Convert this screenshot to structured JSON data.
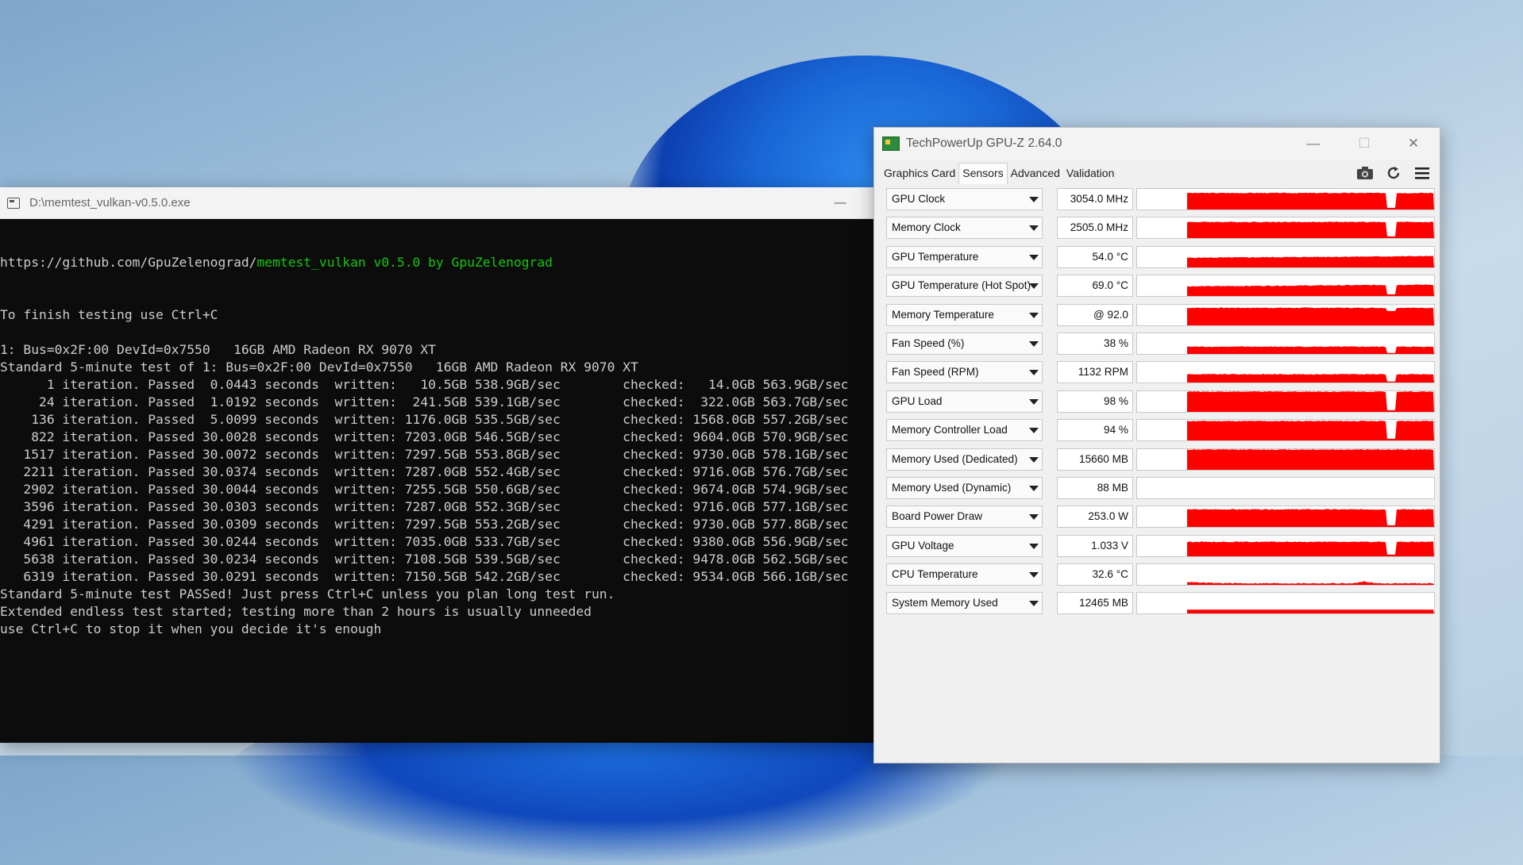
{
  "console": {
    "title": "D:\\memtest_vulkan-v0.5.0.exe",
    "line1_url": "https://github.com/GpuZelenograd/",
    "line1_app": "memtest_vulkan v0.5.0 by GpuZelenograd",
    "lines": [
      "To finish testing use Ctrl+C",
      "",
      "1: Bus=0x2F:00 DevId=0x7550   16GB AMD Radeon RX 9070 XT",
      "Standard 5-minute test of 1: Bus=0x2F:00 DevId=0x7550   16GB AMD Radeon RX 9070 XT",
      "      1 iteration. Passed  0.0443 seconds  written:   10.5GB 538.9GB/sec        checked:   14.0GB 563.9GB/sec",
      "     24 iteration. Passed  1.0192 seconds  written:  241.5GB 539.1GB/sec        checked:  322.0GB 563.7GB/sec",
      "    136 iteration. Passed  5.0099 seconds  written: 1176.0GB 535.5GB/sec        checked: 1568.0GB 557.2GB/sec",
      "    822 iteration. Passed 30.0028 seconds  written: 7203.0GB 546.5GB/sec        checked: 9604.0GB 570.9GB/sec",
      "   1517 iteration. Passed 30.0072 seconds  written: 7297.5GB 553.8GB/sec        checked: 9730.0GB 578.1GB/sec",
      "   2211 iteration. Passed 30.0374 seconds  written: 7287.0GB 552.4GB/sec        checked: 9716.0GB 576.7GB/sec",
      "   2902 iteration. Passed 30.0044 seconds  written: 7255.5GB 550.6GB/sec        checked: 9674.0GB 574.9GB/sec",
      "   3596 iteration. Passed 30.0303 seconds  written: 7287.0GB 552.3GB/sec        checked: 9716.0GB 577.1GB/sec",
      "   4291 iteration. Passed 30.0309 seconds  written: 7297.5GB 553.2GB/sec        checked: 9730.0GB 577.8GB/sec",
      "   4961 iteration. Passed 30.0244 seconds  written: 7035.0GB 533.7GB/sec        checked: 9380.0GB 556.9GB/sec",
      "   5638 iteration. Passed 30.0234 seconds  written: 7108.5GB 539.5GB/sec        checked: 9478.0GB 562.5GB/sec",
      "   6319 iteration. Passed 30.0291 seconds  written: 7150.5GB 542.2GB/sec        checked: 9534.0GB 566.1GB/sec",
      "Standard 5-minute test PASSed! Just press Ctrl+C unless you plan long test run.",
      "Extended endless test started; testing more than 2 hours is usually unneeded",
      "use Ctrl+C to stop it when you decide it's enough"
    ]
  },
  "gpuz": {
    "title": "TechPowerUp GPU-Z 2.64.0",
    "tabs": [
      "Graphics Card",
      "Sensors",
      "Advanced",
      "Validation"
    ],
    "active_tab": "Sensors",
    "graph_color": "#ff0000",
    "sensors": [
      {
        "label": "GPU Clock",
        "value": "3054.0 MHz",
        "level": 0.8,
        "shape": "full-dip"
      },
      {
        "label": "Memory Clock",
        "value": "2505.0 MHz",
        "level": 0.78,
        "shape": "full-dip"
      },
      {
        "label": "GPU Temperature",
        "value": "54.0 °C",
        "level": 0.55,
        "shape": "rise"
      },
      {
        "label": "GPU Temperature (Hot Spot)",
        "value": "69.0 °C",
        "level": 0.55,
        "shape": "rise-dip"
      },
      {
        "label": "Memory Temperature",
        "value": "@ 92.0",
        "level": 0.85,
        "shape": "full-notch"
      },
      {
        "label": "Fan Speed (%)",
        "value": "38 %",
        "level": 0.35,
        "shape": "low-dip"
      },
      {
        "label": "Fan Speed (RPM)",
        "value": "1132 RPM",
        "level": 0.4,
        "shape": "low-dip"
      },
      {
        "label": "GPU Load",
        "value": "98 %",
        "level": 0.98,
        "shape": "full-dip"
      },
      {
        "label": "Memory Controller Load",
        "value": "94 %",
        "level": 0.94,
        "shape": "full-dip"
      },
      {
        "label": "Memory Used (Dedicated)",
        "value": "15660 MB",
        "level": 0.98,
        "shape": "full"
      },
      {
        "label": "Memory Used (Dynamic)",
        "value": "88 MB",
        "level": 0.0,
        "shape": "none"
      },
      {
        "label": "Board Power Draw",
        "value": "253.0 W",
        "level": 0.85,
        "shape": "full-dip"
      },
      {
        "label": "GPU Voltage",
        "value": "1.033 V",
        "level": 0.7,
        "shape": "full-dip"
      },
      {
        "label": "CPU Temperature",
        "value": "32.6 °C",
        "level": 0.15,
        "shape": "noise"
      },
      {
        "label": "System Memory Used",
        "value": "12465 MB",
        "level": 0.18,
        "shape": "flat"
      }
    ]
  }
}
